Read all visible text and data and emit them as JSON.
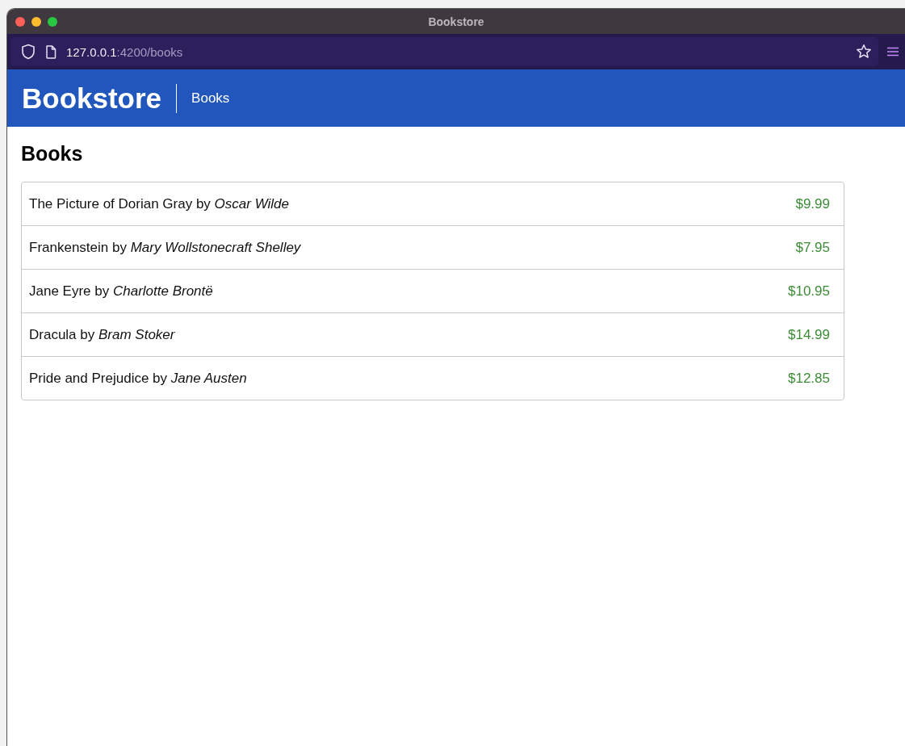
{
  "window": {
    "title": "Bookstore"
  },
  "address_bar": {
    "host": "127.0.0.1",
    "path": ":4200/books"
  },
  "navbar": {
    "brand": "Bookstore",
    "links": [
      "Books"
    ]
  },
  "heading": "Books",
  "books": [
    {
      "text": "The Picture of Dorian Gray by *Oscar Wilde*",
      "price": "$9.99"
    },
    {
      "text": "Frankenstein by *Mary Wollstonecraft Shelley*",
      "price": "$7.95"
    },
    {
      "text": "Jane Eyre by *Charlotte Brontë*",
      "price": "$10.95"
    },
    {
      "text": "Dracula by *Bram Stoker*",
      "price": "$14.99"
    },
    {
      "text": "Pride and Prejudice by *Jane Austen*",
      "price": "$12.85"
    }
  ]
}
